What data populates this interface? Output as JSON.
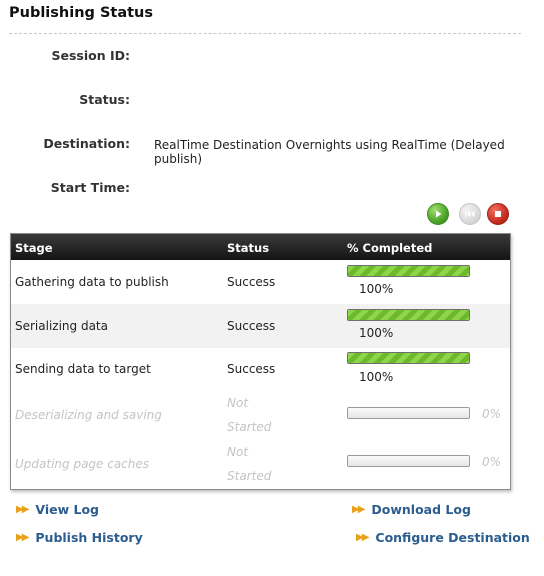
{
  "page": {
    "title": "Publishing Status"
  },
  "fields": {
    "session_label": "Session ID:",
    "session_value": "",
    "status_label": "Status:",
    "status_value": "",
    "destination_label": "Destination:",
    "destination_value": "RealTime Destination Overnights using RealTime (Delayed publish)",
    "start_label": "Start Time:",
    "start_value": ""
  },
  "controls": [
    {
      "name": "play-icon",
      "color": "#4ea42a"
    },
    {
      "name": "rewind-icon",
      "color": "#d6d6d6"
    },
    {
      "name": "stop-icon",
      "color": "#c42a1c"
    }
  ],
  "table": {
    "headers": {
      "stage": "Stage",
      "status": "Status",
      "completed": "% Completed"
    },
    "rows": [
      {
        "stage": "Gathering data to publish",
        "status1": "Success",
        "status2": "",
        "percent_label": "100%",
        "progress": 100,
        "active": true
      },
      {
        "stage": "Serializing data",
        "status1": "Success",
        "status2": "",
        "percent_label": "100%",
        "progress": 100,
        "active": true
      },
      {
        "stage": "Sending data to target",
        "status1": "Success",
        "status2": "",
        "percent_label": "100%",
        "progress": 100,
        "active": true
      },
      {
        "stage": "Deserializing and saving",
        "status1": "Not",
        "status2": "Started",
        "percent_label": "0%",
        "progress": 0,
        "active": false
      },
      {
        "stage": "Updating page caches",
        "status1": "Not",
        "status2": "Started",
        "percent_label": "0%",
        "progress": 0,
        "active": false
      }
    ]
  },
  "links": {
    "view_log": "View Log",
    "download_log": "Download Log",
    "publish_history": "Publish History",
    "configure_destination": "Configure Destination"
  },
  "colors": {
    "link": "#2c5d8f",
    "arrow": "#e8a21a",
    "progress": "#8fd44a",
    "header_bg": "#1e1e1e"
  }
}
